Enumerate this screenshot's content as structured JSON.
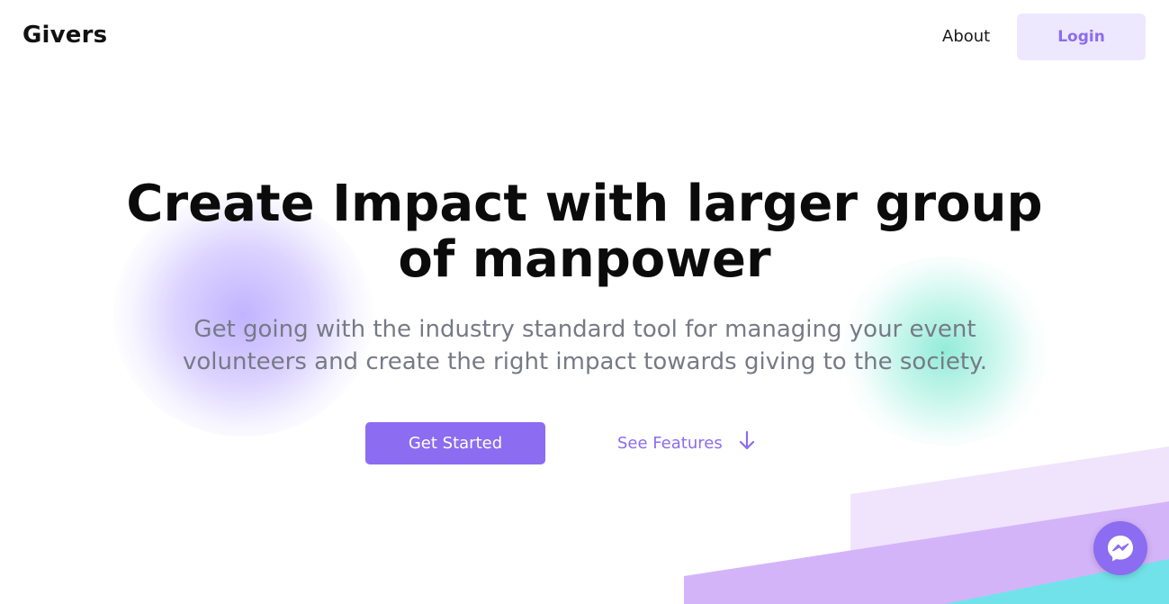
{
  "header": {
    "brand": "Givers",
    "nav": {
      "about_label": "About",
      "login_label": "Login"
    }
  },
  "hero": {
    "title": "Create Impact with larger group of manpower",
    "subtitle": "Get going with the industry standard tool for managing your event volunteers and create the right impact towards giving to the society.",
    "primary_cta": "Get Started",
    "secondary_cta": "See Features"
  },
  "icons": {
    "features_arrow": "arrow-down-icon",
    "chat": "messenger-icon"
  },
  "colors": {
    "accent": "#8c6cf0",
    "accent_light": "#ede8fe",
    "text_dark": "#0b0b0b",
    "text_muted": "#777a86",
    "blob_purple": "#c4b6ff",
    "blob_teal": "#80e8d2",
    "band_light": "#f0e4fd",
    "band_mid": "#d4b4f9",
    "band_teal": "#72e2ea"
  }
}
